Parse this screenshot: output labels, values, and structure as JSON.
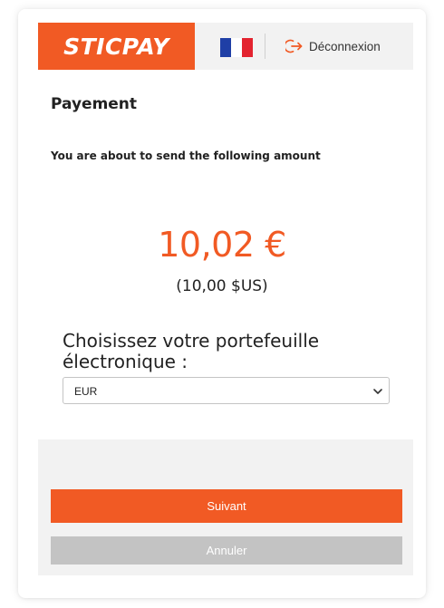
{
  "header": {
    "logo_text": "STICPAY",
    "language_flag": "france-flag-icon",
    "logout_label": "Déconnexion",
    "logout_icon": "logout-icon"
  },
  "main": {
    "title": "Payement",
    "intro": "You are about to send the following amount",
    "amount": "10,02 €",
    "converted_amount": "(10,00 $US)",
    "wallet_label": "Choisissez votre portefeuille électronique :",
    "wallet_select": {
      "selected": "EUR"
    }
  },
  "actions": {
    "next_label": "Suivant",
    "cancel_label": "Annuler"
  },
  "colors": {
    "accent": "#f15a24",
    "header_bg": "#f2f2f2",
    "cancel_bg": "#c3c3c3",
    "flag_blue": "#1f3fa6",
    "flag_red": "#e3232f"
  }
}
